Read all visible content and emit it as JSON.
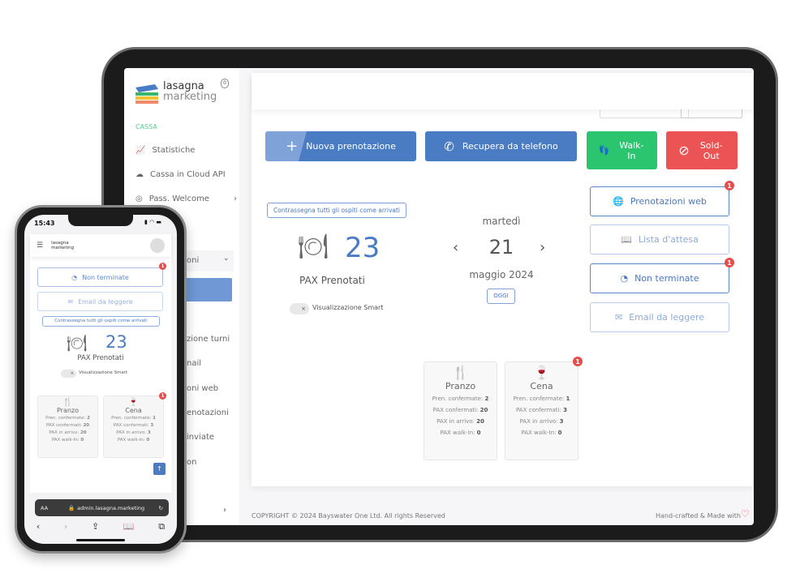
{
  "sidebar": {
    "logo_line1": "lasagna",
    "logo_line2": "marketing",
    "section": "CASSA",
    "items": [
      {
        "label": "Statistiche",
        "icon": "chart-icon"
      },
      {
        "label": "Cassa in Cloud API",
        "icon": "cloud-icon"
      },
      {
        "label": "Pass. Welcome",
        "icon": "fingerprint-icon"
      }
    ],
    "partial_items": [
      "oni",
      "zione turni",
      "nail",
      "oni web",
      "enotazioni",
      "inviate",
      "on"
    ]
  },
  "actions": {
    "new_booking": "Nuova prenotazione",
    "recover_phone": "Recupera da telefono",
    "walk_in": "Walk-In",
    "sold_out": "Sold-Out"
  },
  "colors": {
    "primary": "#4a7cc4",
    "green": "#2cc56f",
    "red": "#eb5354",
    "badge": "#e74c4c"
  },
  "mark_all_arrived": "Contrassegna tutti gli ospiti come arrivati",
  "pax": {
    "count": "23",
    "label": "PAX Prenotati",
    "smart_view": "Visualizzazione Smart",
    "smart_view_on": false
  },
  "date": {
    "weekday": "martedì",
    "day": "21",
    "month_year": "maggio 2024",
    "today": "OGGI"
  },
  "side_buttons": [
    {
      "label": "Prenotazioni web",
      "icon": "globe-icon",
      "badge": "1"
    },
    {
      "label": "Lista d'attesa",
      "icon": "book-icon",
      "badge": ""
    },
    {
      "label": "Non terminate",
      "icon": "timer-icon",
      "badge": "1"
    },
    {
      "label": "Email da leggere",
      "icon": "mail-icon",
      "badge": ""
    }
  ],
  "meals": [
    {
      "name": "Pranzo",
      "icon": "fork-knife-icon",
      "badge": "",
      "rows": [
        [
          "Pren. confermate:",
          "2"
        ],
        [
          "PAX confermati:",
          "20"
        ],
        [
          "PAX in arrivo:",
          "20"
        ],
        [
          "PAX walk-In:",
          "0"
        ]
      ]
    },
    {
      "name": "Cena",
      "icon": "wine-glass-icon",
      "badge": "1",
      "rows": [
        [
          "Pren. confermate:",
          "1"
        ],
        [
          "PAX confermati:",
          "3"
        ],
        [
          "PAX in arrivo:",
          "3"
        ],
        [
          "PAX walk-In:",
          "0"
        ]
      ]
    }
  ],
  "footer": {
    "copyright": "COPYRIGHT © 2024 Bayswater One Ltd. All rights Reserved",
    "made_with": "Hand-crafted & Made with"
  },
  "phone": {
    "time": "15:43",
    "url": "admin.lasagna.marketing",
    "text_size": "AA"
  }
}
